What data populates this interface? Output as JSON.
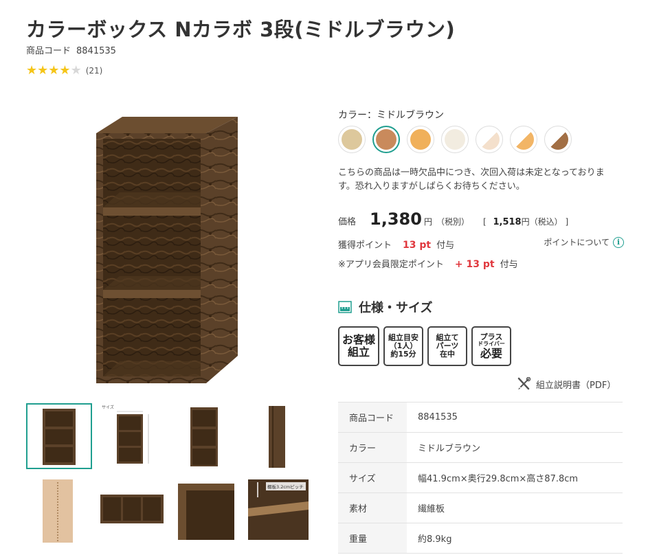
{
  "product": {
    "title": "カラーボックス Nカラボ 3段(ミドルブラウン)",
    "code_label": "商品コード",
    "code_value": "8841535",
    "rating": 4,
    "review_count": "(21)"
  },
  "color": {
    "label": "カラー：ミドルブラウン",
    "swatches": [
      {
        "name": "natural",
        "color": "#ddc89c"
      },
      {
        "name": "middle-brown",
        "color": "#c98a5c",
        "selected": true
      },
      {
        "name": "orange",
        "color": "#f0b05a"
      },
      {
        "name": "white",
        "color": "#f2ece0"
      },
      {
        "name": "white-light-wood",
        "color": "#f4e0cc"
      },
      {
        "name": "white-natural",
        "color": "#f2b566"
      },
      {
        "name": "dark-brown-white",
        "color": "#a26f45"
      }
    ]
  },
  "stock_notice": "こちらの商品は一時欠品中につき、次回入荷は未定となっております。恐れ入りますがしばらくお待ちください。",
  "price": {
    "label": "価格",
    "value": "1,380",
    "unit": "円",
    "tax_excluded": "（税別）",
    "bracket_open": "[",
    "tax_included_value": "1,518",
    "tax_included_unit": "円（税込）",
    "bracket_close": "]"
  },
  "points": {
    "label": "獲得ポイント",
    "value": "13 pt",
    "suffix": "付与",
    "about_label": "ポイントについて",
    "app_label": "※アプリ会員限定ポイント",
    "app_value": "+ 13 pt",
    "app_suffix": "付与"
  },
  "spec": {
    "heading": "仕様・サイズ",
    "badges": [
      {
        "l1": "お客様",
        "l2": "組立"
      },
      {
        "l1": "組立目安",
        "l2": "（1人）",
        "l3": "約15分"
      },
      {
        "l1": "組立て",
        "l2": "パーツ",
        "l3": "在中"
      },
      {
        "l1": "プラス",
        "l2": "ドライバー",
        "l3": "必要"
      }
    ],
    "manual_label": "組立説明書（PDF）",
    "rows": [
      {
        "key": "商品コード",
        "value": "8841535"
      },
      {
        "key": "カラー",
        "value": "ミドルブラウン"
      },
      {
        "key": "サイズ",
        "value": "幅41.9cm×奥行29.8cm×高さ87.8cm"
      },
      {
        "key": "素材",
        "value": "繊維板"
      },
      {
        "key": "重量",
        "value": "約8.9kg"
      }
    ]
  },
  "images": {
    "thumb2_label": "サイズ",
    "thumb8_label": "棚板3.2cmピッチ"
  }
}
